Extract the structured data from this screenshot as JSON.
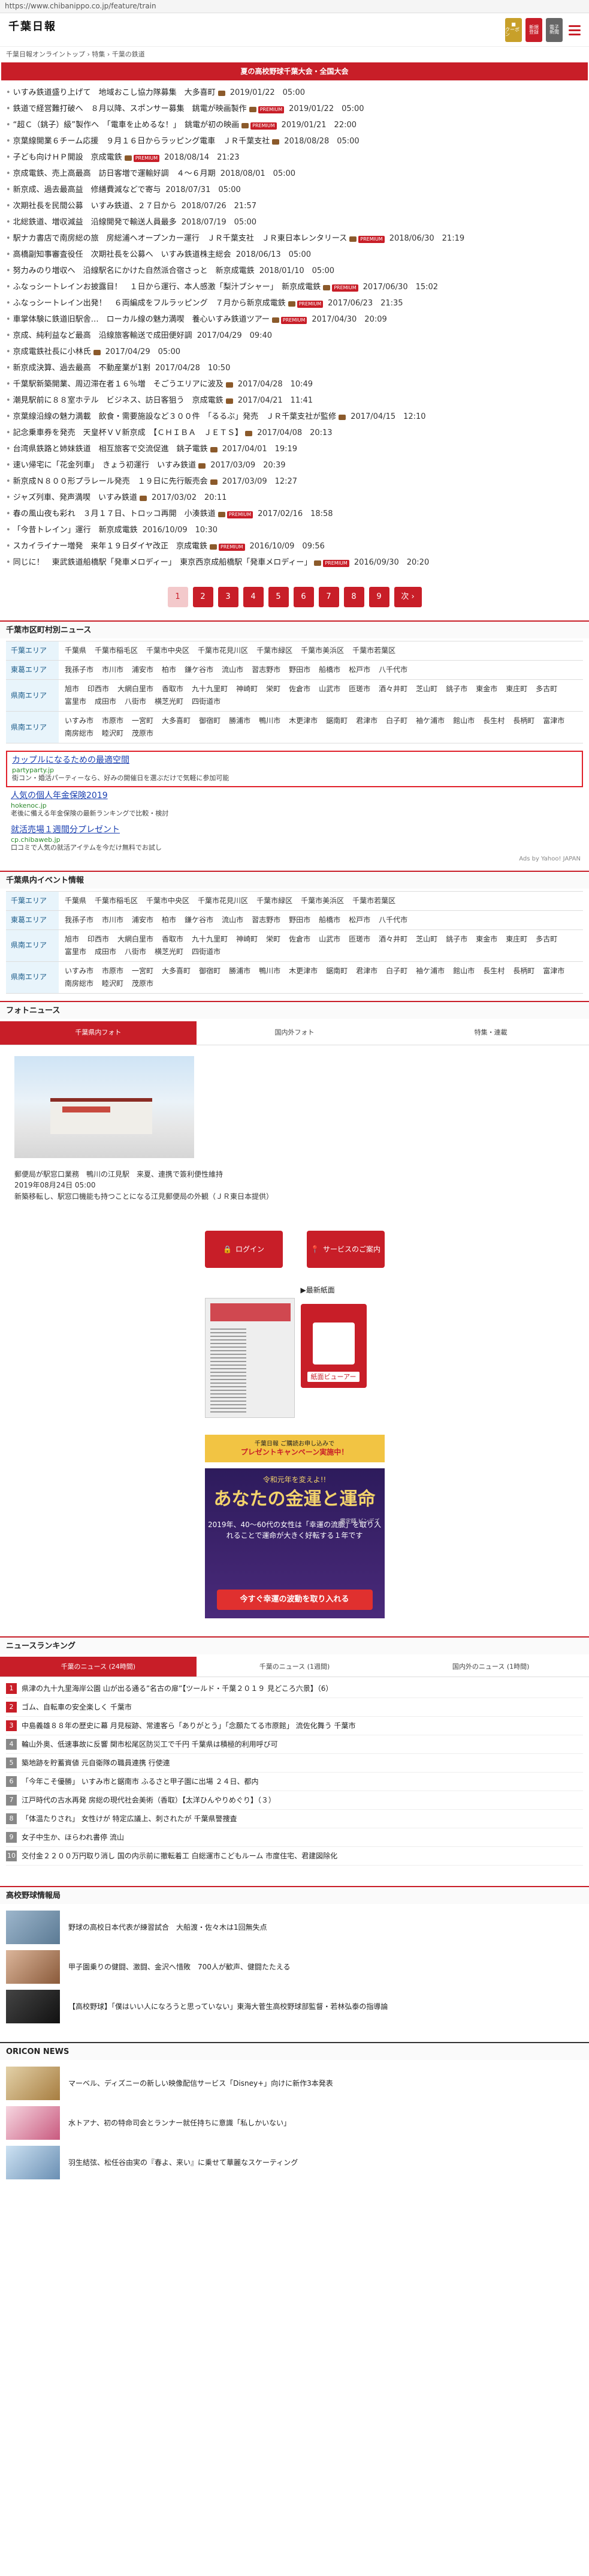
{
  "url": "https://www.chibanippo.co.jp/feature/train",
  "header": {
    "logo": "千葉日報",
    "btn_coupon": "クーポン",
    "btn_register_1": "新規",
    "btn_register_2": "登録",
    "btn_epaper_1": "電子",
    "btn_epaper_2": "新聞"
  },
  "breadcrumb": "千葉日報オンライントップ › 特集 › 千葉の鉄道",
  "featured": "夏の高校野球千葉大会・全国大会",
  "news": [
    {
      "title": "いすみ鉄道盛り上げて　地域おこし協力隊募集　大多喜町",
      "date": "2019/01/22　05:00",
      "cam": true,
      "paid": false
    },
    {
      "title": "鉄道で経営難打破へ　８月以降、スポンサー募集　銚電が映画製作",
      "date": "2019/01/22　05:00",
      "cam": true,
      "paid": true
    },
    {
      "title": "“超Ｃ（銚子）級”製作へ　「電車を止めるな！」　銚電が初の映画",
      "date": "2019/01/21　22:00",
      "cam": true,
      "paid": true
    },
    {
      "title": "京葉線開業６チーム応援　９月１６日からラッピング電車　ＪＲ千葉支社",
      "date": "2018/08/28　05:00",
      "cam": true,
      "paid": false
    },
    {
      "title": "子ども向けＨＰ開設　京成電鉄",
      "date": "2018/08/14　21:23",
      "cam": true,
      "paid": true
    },
    {
      "title": "京成電鉄、売上高最高　訪日客増で運輸好調　４～６月期",
      "date": "2018/08/01　05:00",
      "cam": false,
      "paid": false
    },
    {
      "title": "新京成、過去最高益　修繕費減などで寄与",
      "date": "2018/07/31　05:00",
      "cam": false,
      "paid": false
    },
    {
      "title": "次期社長を民間公募　いすみ鉄道、２７日から",
      "date": "2018/07/26　21:57",
      "cam": false,
      "paid": false
    },
    {
      "title": "北総鉄道、増収減益　沿線開発で輸送人員最多",
      "date": "2018/07/19　05:00",
      "cam": false,
      "paid": false
    },
    {
      "title": "駅ナカ書店で南房総の旅　房総浦へオープンカー運行　ＪＲ千葉支社　ＪＲ東日本レンタリース",
      "date": "2018/06/30　21:19",
      "cam": true,
      "paid": true
    },
    {
      "title": "高橋副知事審査役任　次期社長を公募へ　いすみ鉄道株主総会",
      "date": "2018/06/13　05:00",
      "cam": false,
      "paid": false
    },
    {
      "title": "努力みのり増収へ　沿線駅名にかけた自然派合宿さっと　新京成電鉄",
      "date": "2018/01/10　05:00",
      "cam": false,
      "paid": false
    },
    {
      "title": "ふなっシートレインお披露目！　１日から運行、本人感激「梨汁ブシャー」　新京成電鉄",
      "date": "2017/06/30　15:02",
      "cam": true,
      "paid": true
    },
    {
      "title": "ふなっシートレイン出発！　６両編成をフルラッピング　７月から新京成電鉄",
      "date": "2017/06/23　21:35",
      "cam": true,
      "paid": true
    },
    {
      "title": "車掌体験に鉄道旧駅舎…　ローカル線の魅力満喫　養心いすみ鉄道ツアー",
      "date": "2017/04/30　20:09",
      "cam": true,
      "paid": true
    },
    {
      "title": "京成、純利益など最高　沿線旅客輸送で成田便好調",
      "date": "2017/04/29　09:40",
      "cam": false,
      "paid": false
    },
    {
      "title": "京成電鉄社長に小林氏",
      "date": "2017/04/29　05:00",
      "cam": true,
      "paid": false
    },
    {
      "title": "新京成決算、過去最高　不動産業が1割",
      "date": "2017/04/28　10:50",
      "cam": false,
      "paid": false
    },
    {
      "title": "千葉駅新築開業、周辺滞在者１６％増　そごうエリアに波及",
      "date": "2017/04/28　10:49",
      "cam": true,
      "paid": false
    },
    {
      "title": "潮見駅前に８８室ホテル　ビジネス、訪日客狙う　京成電鉄",
      "date": "2017/04/21　11:41",
      "cam": true,
      "paid": false
    },
    {
      "title": "京葉線沿線の魅力満載　飲食・需要施設など３００件　「るるぶ」発売　ＪＲ千葉支社が監修",
      "date": "2017/04/15　12:10",
      "cam": true,
      "paid": false
    },
    {
      "title": "記念乗車券を発売　天皇杯ＶＶ新京成　【ＣＨＩＢＡ　ＪＥＴＳ】",
      "date": "2017/04/08　20:13",
      "cam": true,
      "paid": false
    },
    {
      "title": "台湾県鉄路と姉妹鉄道　相互旅客で交流促進　銚子電鉄",
      "date": "2017/04/01　19:19",
      "cam": true,
      "paid": false
    },
    {
      "title": "速い帰宅に「花金列車」　きょう初運行　いすみ鉄道",
      "date": "2017/03/09　20:39",
      "cam": true,
      "paid": false
    },
    {
      "title": "新京成Ｎ８００形プラレール発売　１９日に先行販売会",
      "date": "2017/03/09　12:27",
      "cam": true,
      "paid": false
    },
    {
      "title": "ジャズ列車、発声満喫　いすみ鉄道",
      "date": "2017/03/02　20:11",
      "cam": true,
      "paid": false
    },
    {
      "title": "春の風山夜も彩れ　３月１７日、トロッコ再開　小湊鉄道",
      "date": "2017/02/16　18:58",
      "cam": true,
      "paid": true
    },
    {
      "title": "「今昔トレイン」運行　新京成電鉄",
      "date": "2016/10/09　10:30",
      "cam": false,
      "paid": false
    },
    {
      "title": "スカイライナー増発　来年１９日ダイヤ改正　京成電鉄",
      "date": "2016/10/09　09:56",
      "cam": true,
      "paid": true
    },
    {
      "title": "同じに！　東武鉄道船橋駅「発車メロディー」　東京西京成船橋駅「発車メロディー」",
      "date": "2016/09/30　20:20",
      "cam": true,
      "paid": true
    }
  ],
  "pagination": [
    "1",
    "2",
    "3",
    "4",
    "5",
    "6",
    "7",
    "8",
    "9",
    "次 ›"
  ],
  "municipal": {
    "title": "千葉市区町村別ニュース",
    "rows": [
      {
        "head": "千葉エリア",
        "items": [
          "千葉県",
          "千葉市稲毛区",
          "千葉市中央区",
          "千葉市花見川区",
          "千葉市緑区",
          "千葉市美浜区",
          "千葉市若葉区"
        ]
      },
      {
        "head": "東葛エリア",
        "items": [
          "我孫子市",
          "市川市",
          "浦安市",
          "柏市",
          "鎌ケ谷市",
          "流山市",
          "習志野市",
          "野田市",
          "船橋市",
          "松戸市",
          "八千代市"
        ]
      },
      {
        "head": "県南エリア",
        "items": [
          "旭市",
          "印西市",
          "大網白里市",
          "香取市",
          "九十九里町",
          "神崎町",
          "栄町",
          "佐倉市",
          "山武市",
          "匝瑳市",
          "酒々井町",
          "芝山町",
          "銚子市",
          "東金市",
          "東庄町",
          "多古町",
          "富里市",
          "成田市",
          "八街市",
          "横芝光町",
          "四街道市"
        ]
      },
      {
        "head": "県南エリア",
        "items": [
          "いすみ市",
          "市原市",
          "一宮町",
          "大多喜町",
          "御宿町",
          "勝浦市",
          "鴨川市",
          "木更津市",
          "鋸南町",
          "君津市",
          "白子町",
          "袖ケ浦市",
          "館山市",
          "長生村",
          "長柄町",
          "富津市",
          "南房総市",
          "睦沢町",
          "茂原市"
        ]
      }
    ]
  },
  "ads": [
    {
      "title": "カップルになるための最適空間",
      "url": "partyparty.jp",
      "desc": "街コン・婚活パーティーなら、好みの開催日を選ぶだけで気軽に参加可能"
    },
    {
      "title": "人気の個人年金保険2019",
      "url": "hokenoc.jp",
      "desc": "老後に備える年金保険の最新ランキングで比較・検討"
    },
    {
      "title": "就活売場１週間分プレゼント",
      "url": "cp.chibaweb.jp",
      "desc": "口コミで人気の就活アイテムを今だけ無料でお試し"
    }
  ],
  "ads_credit": "Ads by Yahoo! JAPAN",
  "events": {
    "title": "千葉県内イベント情報",
    "rows": [
      {
        "head": "千葉エリア",
        "items": [
          "千葉県",
          "千葉市稲毛区",
          "千葉市中央区",
          "千葉市花見川区",
          "千葉市緑区",
          "千葉市美浜区",
          "千葉市若葉区"
        ]
      },
      {
        "head": "東葛エリア",
        "items": [
          "我孫子市",
          "市川市",
          "浦安市",
          "柏市",
          "鎌ケ谷市",
          "流山市",
          "習志野市",
          "野田市",
          "船橋市",
          "松戸市",
          "八千代市"
        ]
      },
      {
        "head": "県南エリア",
        "items": [
          "旭市",
          "印西市",
          "大網白里市",
          "香取市",
          "九十九里町",
          "神崎町",
          "栄町",
          "佐倉市",
          "山武市",
          "匝瑳市",
          "酒々井町",
          "芝山町",
          "銚子市",
          "東金市",
          "東庄町",
          "多古町",
          "富里市",
          "成田市",
          "八街市",
          "横芝光町",
          "四街道市"
        ]
      },
      {
        "head": "県南エリア",
        "items": [
          "いすみ市",
          "市原市",
          "一宮町",
          "大多喜町",
          "御宿町",
          "勝浦市",
          "鴨川市",
          "木更津市",
          "鋸南町",
          "君津市",
          "白子町",
          "袖ケ浦市",
          "館山市",
          "長生村",
          "長柄町",
          "富津市",
          "南房総市",
          "睦沢町",
          "茂原市"
        ]
      }
    ]
  },
  "photo": {
    "title": "フォトニュース",
    "tabs": [
      "千葉県内フォト",
      "国内外フォト",
      "特集・連載"
    ],
    "caption_1": "郵便局が駅窓口業務　鴨川の江見駅　来夏、連携で簽利便性維持",
    "caption_2": "2019年08月24日 05:00",
    "caption_3": "新築移転し、駅窓口機能も持つことになる江見郵便局の外観（ＪＲ東日本提供）",
    "login": "ログイン",
    "service": "サービスのご案内",
    "latest": "▶最新紙面",
    "viewer": "紙面ビューアー",
    "promo_top": "千葉日報 ご購読お申し込みで",
    "promo_sub": "プレゼントキャンペーン実施中！",
    "fortune_top": "令和元年を変えよ!!",
    "fortune_big": "あなたの金運と運命",
    "fortune_text": "2019年、40〜60代の女性は「幸運の流脈」を取り入れることで運命が大きく好転する１年です",
    "fortune_small": "鑑定師 ビンデズ",
    "fortune_btn": "今すぐ幸運の波動を取り入れる"
  },
  "ranking": {
    "title": "ニュースランキング",
    "tabs": [
      "千葉のニュース (24時間)",
      "千葉のニュース (1週間)",
      "国内外のニュース (1時間)"
    ],
    "items": [
      "県津の九十九里海岸公園 山が出る通る”名古の扉”【ツールド・千葉２０１９ 見どころ六景】（6）",
      "ゴム、自転車の安全楽しく 千葉市",
      "中島義雄８８年の歴史に幕 月見桜跡、常連客ら「ありがとう」「念願たてる市原館」 流佐化舞う 千葉市",
      "輪山外奥、低速事故に反響 関市松尾区防災工で千円 千葉県は積極的利用呼び可",
      "築地跡を貯蓄資値 元自衛隊の職員連携 行使連",
      "「今年こそ優勝」 いすみ市と鋸南市 ふるさと甲子園に出場 ２４日、都内",
      "江戸時代の古水再発 房総の現代社会美術（香取）【太洋ひんやりめぐり】（３）",
      "「体温たりされ」 女性けが 特定広議上、刺されたが 千葉県警捜査",
      "女子中生か、ほらわれ書停 流山",
      "交付金２２００万円取り消し 国の内示前に撤転着工 白総運市こどもルーム 市度住宅、君建図除化"
    ]
  },
  "baseball": {
    "title": "高校野球情報局",
    "items": [
      "野球の高校日本代表が練習試合　大船渡・佐々木は1回無失点",
      "甲子園乗りの健闘、激闘、金沢へ惜敗　700人が歓声、健闘たたえる",
      "【高校野球】「僕はいい人になろうと思っていない」東海大菅生高校野球部監督・若林弘泰の指導論"
    ]
  },
  "oricon": {
    "title": "ORICON NEWS",
    "items": [
      "マーベル、ディズニーの新しい映像配信サービス「Disney+」向けに新作3本発表",
      "水トアナ、初の特命司会とランナー就任持ちに意識「私しかいない」",
      "羽生結弦、松任谷由実の『春よ、来い』に乗せて華麗なスケーティング"
    ]
  },
  "colors": {
    "brand": "#c81e28",
    "area_bg": "#e8f4fb",
    "area_text": "#1c5c8a"
  }
}
